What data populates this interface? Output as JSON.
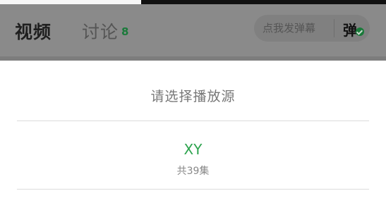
{
  "header": {
    "tabs": [
      {
        "label": "视频",
        "active": true
      },
      {
        "label": "讨论",
        "badge": "8",
        "active": false
      }
    ],
    "danmaku": {
      "placeholder": "点我发弹幕",
      "toggle_label": "弹",
      "toggle_icon": "check-circle-icon",
      "toggle_enabled": true
    }
  },
  "sheet": {
    "title": "请选择播放源",
    "sources": [
      {
        "name": "XY",
        "episodes": "共39集"
      }
    ]
  },
  "colors": {
    "accent_green": "#2ea44f",
    "badge_green": "#1a7a3a",
    "overlay": "#8e8e8e",
    "sheet_bg": "#ffffff"
  }
}
